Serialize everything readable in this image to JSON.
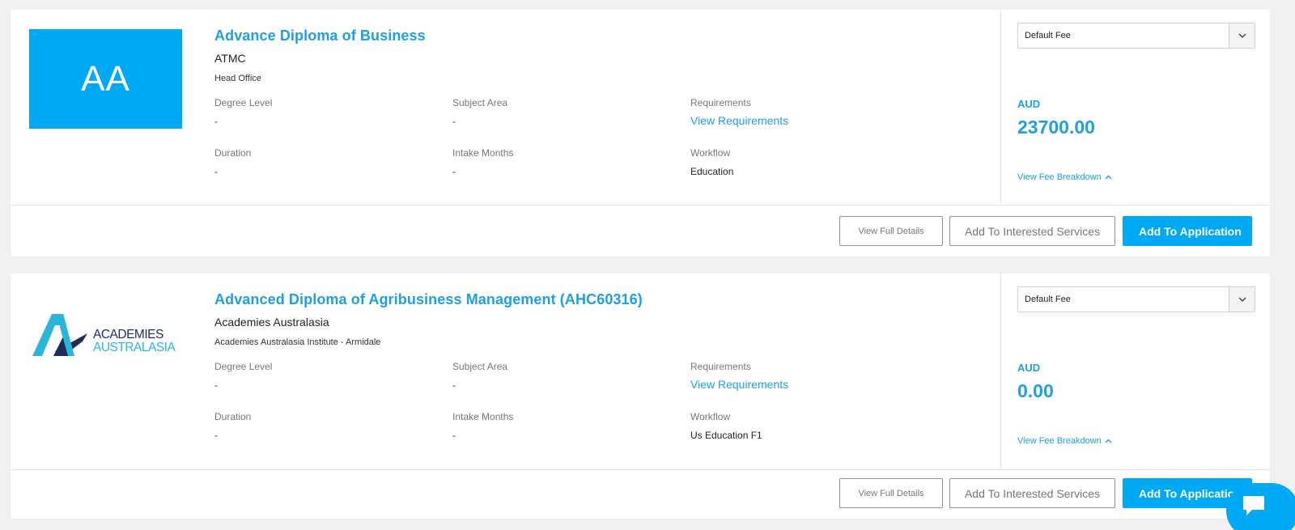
{
  "colors": {
    "accent": "#00a9f4",
    "link": "#1f9fe0"
  },
  "labels": {
    "degree_level": "Degree Level",
    "subject_area": "Subject Area",
    "requirements": "Requirements",
    "duration": "Duration",
    "intake_months": "Intake Months",
    "workflow": "Workflow",
    "view_requirements": "View Requirements",
    "view_fee_breakdown": "View Fee Breakdown",
    "view_full_details": "View Full Details",
    "add_to_interested": "Add To Interested Services",
    "add_to_application": "Add To Application"
  },
  "courses": [
    {
      "logo_text": "AA",
      "title": "Advance Diploma of Business",
      "provider": "ATMC",
      "branch": "Head Office",
      "degree_level": "-",
      "subject_area": "-",
      "duration": "-",
      "intake_months": "-",
      "workflow": "Education",
      "fee_option": "Default Fee",
      "currency": "AUD",
      "amount": "23700.00"
    },
    {
      "logo_top": "ACADEMIES",
      "logo_bottom": "AUSTRALASIA",
      "title": "Advanced Diploma of Agribusiness Management (AHC60316)",
      "provider": "Academies Australasia",
      "branch": "Academies Australasia Institute - Armidale",
      "degree_level": "-",
      "subject_area": "-",
      "duration": "-",
      "intake_months": "-",
      "workflow": "Us Education F1",
      "fee_option": "Default Fee",
      "currency": "AUD",
      "amount": "0.00"
    }
  ],
  "icons": {
    "dropdown": "chevron-down-icon",
    "fee_toggle": "chevron-up-icon",
    "chat": "chat-icon"
  }
}
